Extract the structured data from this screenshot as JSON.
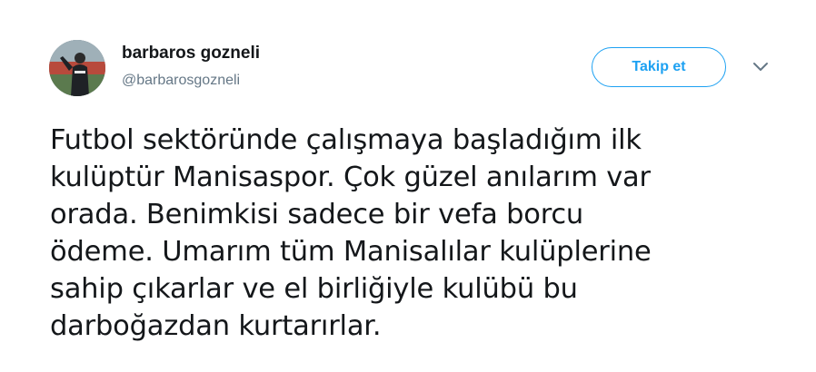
{
  "author": {
    "name": "barbaros gozneli",
    "handle": "@barbarosgozneli",
    "avatar_icon": "profile-photo"
  },
  "actions": {
    "follow_label": "Takip et",
    "more_icon": "chevron-down-icon"
  },
  "tweet": {
    "lines": [
      "Futbol sektöründe çalışmaya başladığım ilk",
      "kulüptür Manisaspor. Çok güzel anılarım var",
      "orada. Benimkisi sadece bir vefa borcu",
      "ödeme. Umarım tüm Manisalılar kulüplerine",
      "sahip çıkarlar ve el birliğiyle kulübü bu",
      "darboğazdan kurtarırlar."
    ]
  },
  "colors": {
    "accent": "#1da1f2",
    "text": "#14171a",
    "secondary": "#657786"
  }
}
